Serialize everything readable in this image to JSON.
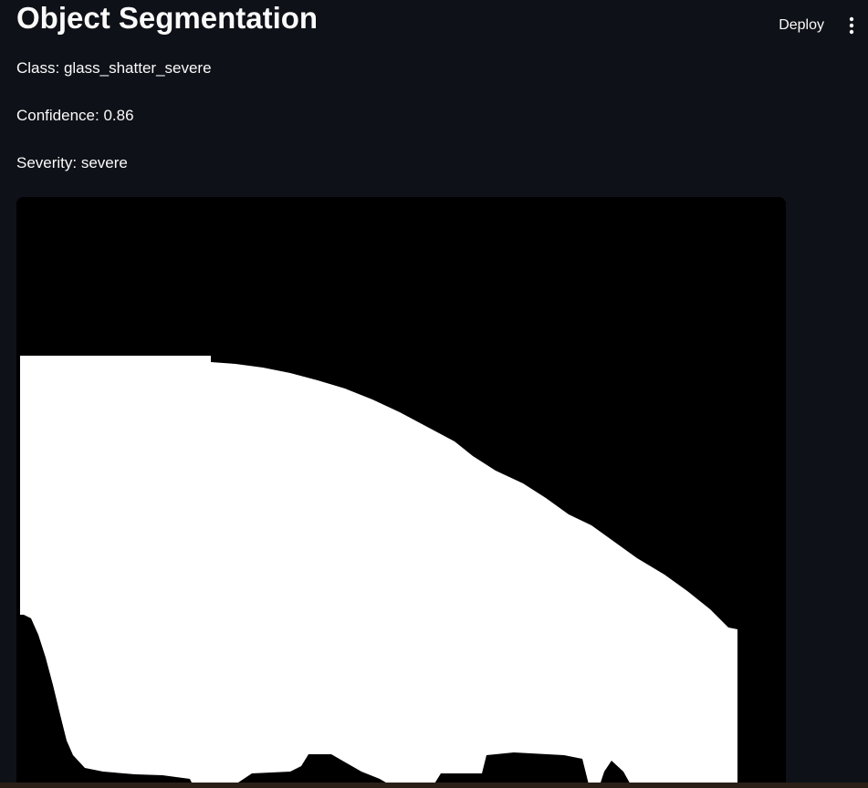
{
  "header": {
    "title": "Object Segmentation",
    "deploy_label": "Deploy",
    "menu_icon": "vertical-dots-icon"
  },
  "result": {
    "class_line": "Class: glass_shatter_severe",
    "confidence_line": "Confidence: 0.86",
    "severity_line": "Severity: severe"
  },
  "mask_image": {
    "foreground_color": "#ffffff",
    "background_color": "#000000"
  },
  "colors": {
    "app_background": "#0e1117",
    "text": "#fafafa"
  }
}
